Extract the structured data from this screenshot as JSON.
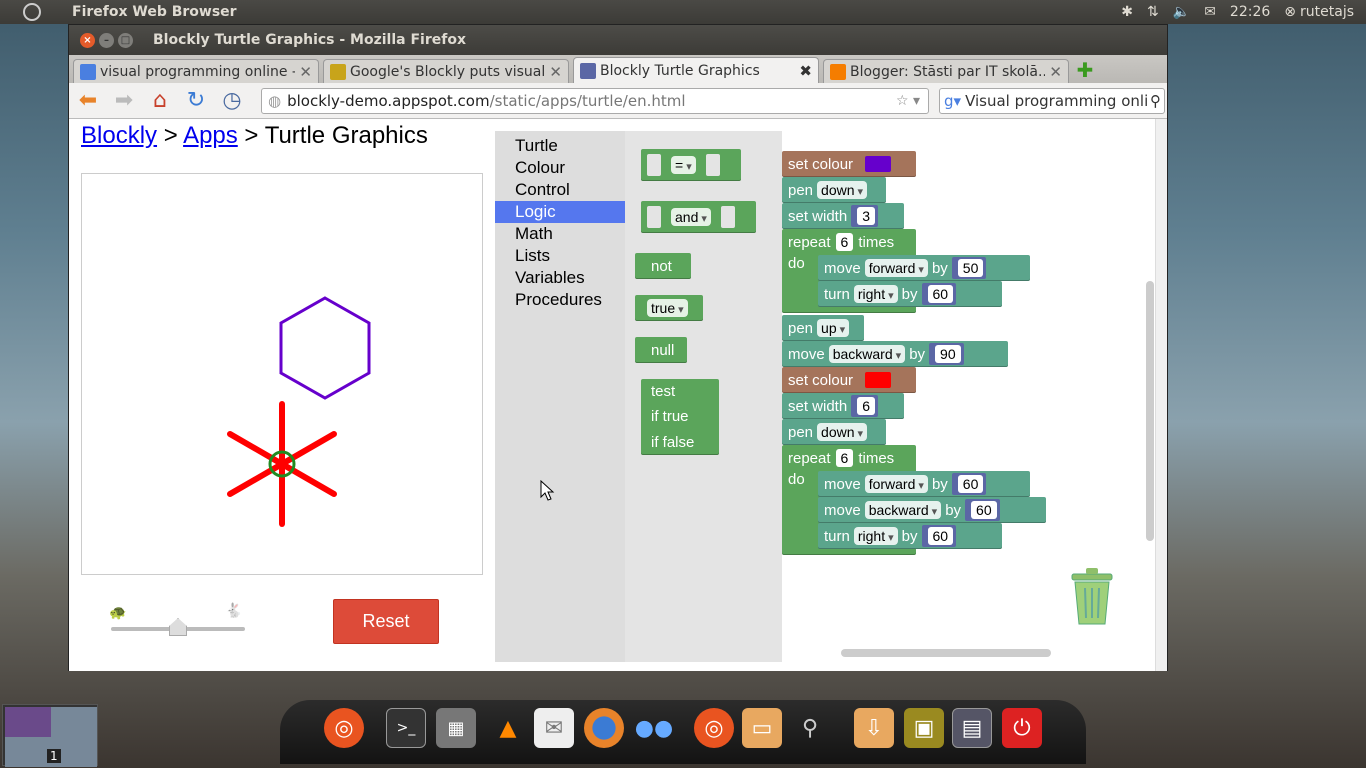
{
  "top_panel": {
    "app_name": "Firefox Web Browser",
    "clock": "22:26",
    "user": "rutetajs"
  },
  "window": {
    "title": "Blockly Turtle Graphics - Mozilla Firefox"
  },
  "tabs": [
    {
      "label": "visual programming online -...",
      "favicon_color": "#4a7fe0",
      "active": false
    },
    {
      "label": "Google's Blockly puts visual...",
      "favicon_color": "#c8a41a",
      "active": false
    },
    {
      "label": "Blockly Turtle Graphics",
      "favicon_color": "#5b67a5",
      "active": true
    },
    {
      "label": "Blogger: Stāsti par IT skolā....",
      "favicon_color": "#f57d00",
      "active": false
    }
  ],
  "nav": {
    "url_host": "blockly-demo.appspot.com",
    "url_path": "/static/apps/turtle/en.html",
    "search_value": "Visual programming onlir"
  },
  "page": {
    "breadcrumb": {
      "link1": "Blockly",
      "sep1": " > ",
      "link2": "Apps",
      "sep2": " > ",
      "current": "Turtle Graphics"
    },
    "reset_label": "Reset",
    "speed_level": 0.5
  },
  "toolbox": {
    "items": [
      "Turtle",
      "Colour",
      "Control",
      "Logic",
      "Math",
      "Lists",
      "Variables",
      "Procedures"
    ],
    "selected": "Logic"
  },
  "flyout": {
    "compare_op": "=",
    "logic_op": "and",
    "not_label": "not",
    "bool_value": "true",
    "null_label": "null",
    "ternary_test": "test",
    "ternary_if_true": "if true",
    "ternary_if_false": "if false"
  },
  "program": {
    "b1": {
      "label": "set colour",
      "colour": "#6600cc"
    },
    "b2": {
      "label": "pen",
      "value": "down"
    },
    "b3": {
      "label": "set width",
      "value": "3"
    },
    "b4": {
      "label": "repeat",
      "count": "6",
      "suffix": "times",
      "do": "do"
    },
    "b5": {
      "label": "move",
      "dir": "forward",
      "by": "by",
      "value": "50"
    },
    "b6": {
      "label": "turn",
      "dir": "right",
      "by": "by",
      "value": "60"
    },
    "b7": {
      "label": "pen",
      "value": "up"
    },
    "b8": {
      "label": "move",
      "dir": "backward",
      "by": "by",
      "value": "90"
    },
    "b9": {
      "label": "set colour",
      "colour": "#ff0000"
    },
    "b10": {
      "label": "set width",
      "value": "6"
    },
    "b11": {
      "label": "pen",
      "value": "down"
    },
    "b12": {
      "label": "repeat",
      "count": "6",
      "suffix": "times",
      "do": "do"
    },
    "b13": {
      "label": "move",
      "dir": "forward",
      "by": "by",
      "value": "60"
    },
    "b14": {
      "label": "move",
      "dir": "backward",
      "by": "by",
      "value": "60"
    },
    "b15": {
      "label": "turn",
      "dir": "right",
      "by": "by",
      "value": "60"
    }
  },
  "taskbar": {
    "workspace_number": "1"
  }
}
